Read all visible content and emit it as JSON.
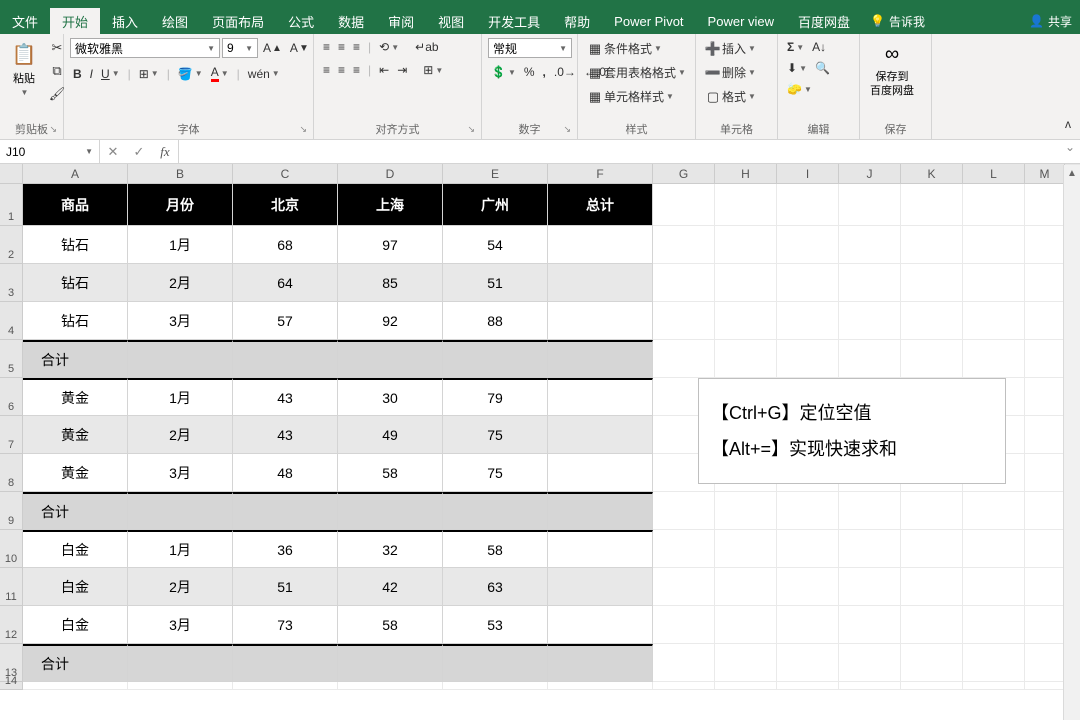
{
  "tabs": {
    "file": "文件",
    "home": "开始",
    "insert": "插入",
    "draw": "绘图",
    "layout": "页面布局",
    "formulas": "公式",
    "data": "数据",
    "review": "审阅",
    "view": "视图",
    "developer": "开发工具",
    "help": "帮助",
    "pp": "Power Pivot",
    "pv": "Power view",
    "baidu": "百度网盘",
    "tell": "告诉我",
    "share": "共享"
  },
  "ribbon": {
    "clipboard": {
      "paste": "粘贴",
      "label": "剪贴板"
    },
    "font": {
      "name": "微软雅黑",
      "size": "9",
      "label": "字体"
    },
    "align": {
      "label": "对齐方式"
    },
    "number": {
      "format": "常规",
      "label": "数字"
    },
    "styles": {
      "cond": "条件格式",
      "table": "套用表格格式",
      "cell": "单元格样式",
      "label": "样式"
    },
    "cells": {
      "insert": "插入",
      "delete": "删除",
      "format": "格式",
      "label": "单元格"
    },
    "editing": {
      "label": "编辑"
    },
    "save": {
      "btn": "保存到\n百度网盘",
      "label": "保存"
    }
  },
  "namebox": "J10",
  "columns": [
    "A",
    "B",
    "C",
    "D",
    "E",
    "F",
    "G",
    "H",
    "I",
    "J",
    "K",
    "L",
    "M"
  ],
  "headers": [
    "商品",
    "月份",
    "北京",
    "上海",
    "广州",
    "总计"
  ],
  "rows": [
    {
      "n": 1,
      "type": "header"
    },
    {
      "n": 2,
      "type": "odd",
      "cells": [
        "钻石",
        "1月",
        "68",
        "97",
        "54",
        ""
      ]
    },
    {
      "n": 3,
      "type": "even",
      "cells": [
        "钻石",
        "2月",
        "64",
        "85",
        "51",
        ""
      ]
    },
    {
      "n": 4,
      "type": "odd",
      "cells": [
        "钻石",
        "3月",
        "57",
        "92",
        "88",
        ""
      ]
    },
    {
      "n": 5,
      "type": "sum",
      "label": "合计"
    },
    {
      "n": 6,
      "type": "odd",
      "after": true,
      "cells": [
        "黄金",
        "1月",
        "43",
        "30",
        "79",
        ""
      ]
    },
    {
      "n": 7,
      "type": "even",
      "cells": [
        "黄金",
        "2月",
        "43",
        "49",
        "75",
        ""
      ]
    },
    {
      "n": 8,
      "type": "odd",
      "cells": [
        "黄金",
        "3月",
        "48",
        "58",
        "75",
        ""
      ]
    },
    {
      "n": 9,
      "type": "sum",
      "label": "合计"
    },
    {
      "n": 10,
      "type": "odd",
      "after": true,
      "cells": [
        "白金",
        "1月",
        "36",
        "32",
        "58",
        ""
      ]
    },
    {
      "n": 11,
      "type": "even",
      "cells": [
        "白金",
        "2月",
        "51",
        "42",
        "63",
        ""
      ]
    },
    {
      "n": 12,
      "type": "odd",
      "cells": [
        "白金",
        "3月",
        "73",
        "58",
        "53",
        ""
      ]
    },
    {
      "n": 13,
      "type": "sum",
      "label": "合计"
    }
  ],
  "row_heights": {
    "header": 42,
    "data": 38,
    "sum": 38
  },
  "tip": {
    "l1": "【Ctrl+G】定位空值",
    "l2": "【Alt+=】实现快速求和"
  },
  "colors": {
    "ribbon_green": "#217346",
    "header_black": "#000000"
  }
}
